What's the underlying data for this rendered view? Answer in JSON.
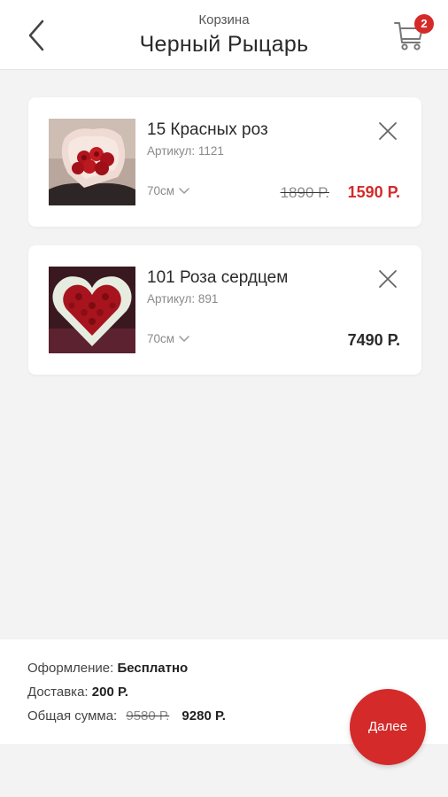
{
  "header": {
    "subtitle": "Корзина",
    "title": "Черный Рыцарь",
    "cart_count": "2"
  },
  "items": [
    {
      "name": "15 Красных роз",
      "sku": "Артикул: 1121",
      "size": "70см",
      "price_old": "1890 Р.",
      "price_new": "1590 Р.",
      "image_icon": "red-roses-bouquet-photo"
    },
    {
      "name": "101 Роза сердцем",
      "sku": "Артикул: 891",
      "size": "70см",
      "price": "7490 Р.",
      "image_icon": "heart-roses-photo"
    }
  ],
  "summary": {
    "design_label": "Оформление:",
    "design_value": "Бесплатно",
    "delivery_label": "Доставка:",
    "delivery_value": "200 Р.",
    "total_label": "Общая сумма:",
    "total_old": "9580 Р.",
    "total_new": "9280 Р."
  },
  "next_button": "Далее",
  "colors": {
    "accent": "#d42a2a",
    "background": "#f3f3f3"
  }
}
